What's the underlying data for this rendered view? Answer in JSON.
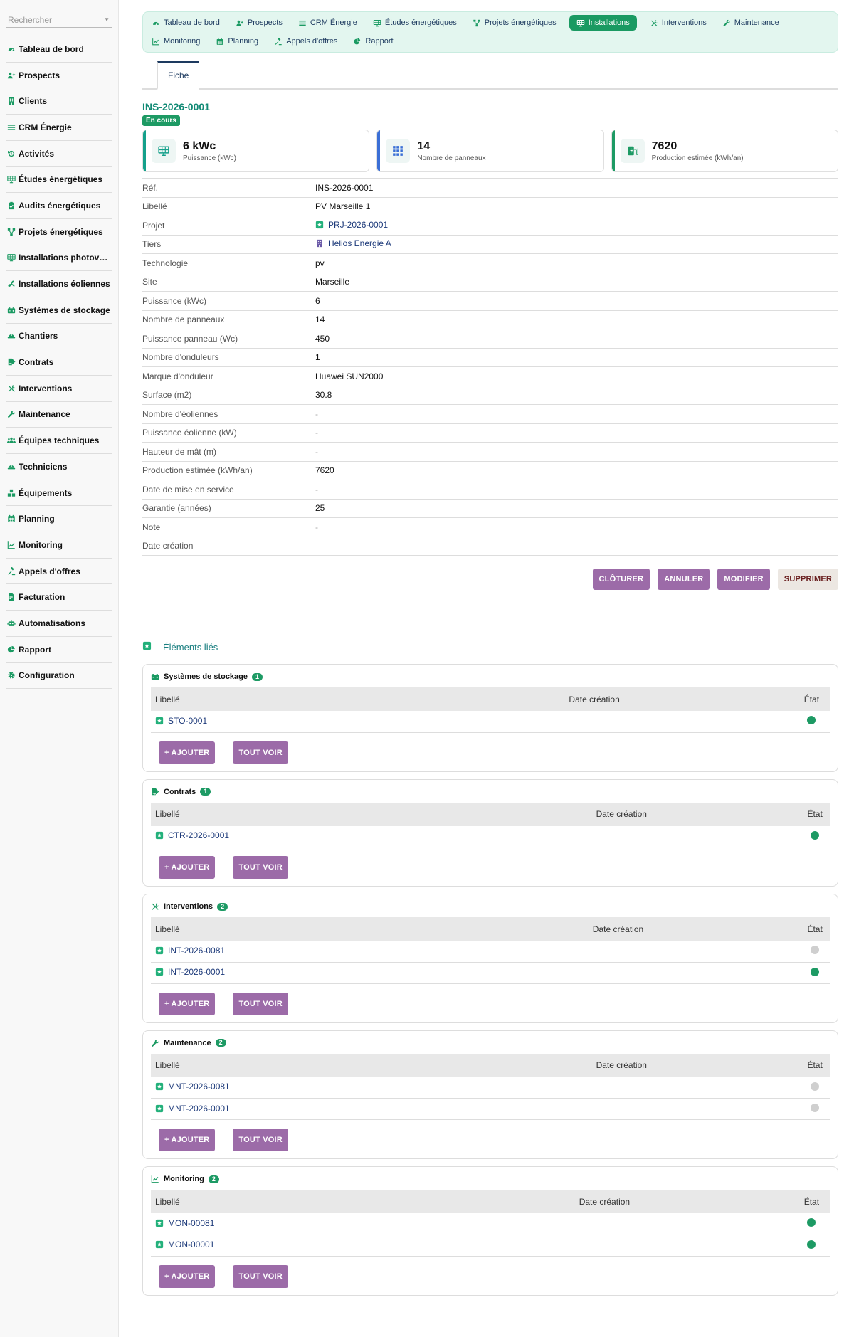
{
  "colors": {
    "accent": "#1a9a62",
    "brand_text": "#1d3a5f",
    "title": "#128a75",
    "action_purple": "#9c6ba8",
    "status_green": "#1d9a64",
    "status_grey": "#cfcfcf"
  },
  "sidebar": {
    "search_placeholder": "Rechercher",
    "items": [
      {
        "label": "Tableau de bord",
        "icon": "gauge-icon"
      },
      {
        "label": "Prospects",
        "icon": "user-plus-icon"
      },
      {
        "label": "Clients",
        "icon": "building-icon"
      },
      {
        "label": "CRM Énergie",
        "icon": "bars-icon"
      },
      {
        "label": "Activités",
        "icon": "history-icon"
      },
      {
        "label": "Études énergétiques",
        "icon": "solar-panel-icon"
      },
      {
        "label": "Audits énergétiques",
        "icon": "clipboard-check-icon"
      },
      {
        "label": "Projets énergétiques",
        "icon": "network-icon"
      },
      {
        "label": "Installations photovoltaïques",
        "icon": "solar-panel-icon"
      },
      {
        "label": "Installations éoliennes",
        "icon": "fan-icon"
      },
      {
        "label": "Systèmes de stockage",
        "icon": "car-battery-icon"
      },
      {
        "label": "Chantiers",
        "icon": "hard-hat-icon"
      },
      {
        "label": "Contrats",
        "icon": "file-signature-icon"
      },
      {
        "label": "Interventions",
        "icon": "tools-icon"
      },
      {
        "label": "Maintenance",
        "icon": "wrench-icon"
      },
      {
        "label": "Équipes techniques",
        "icon": "users-icon"
      },
      {
        "label": "Techniciens",
        "icon": "hard-hat-icon"
      },
      {
        "label": "Équipements",
        "icon": "boxes-icon"
      },
      {
        "label": "Planning",
        "icon": "calendar-icon"
      },
      {
        "label": "Monitoring",
        "icon": "chart-line-icon"
      },
      {
        "label": "Appels d'offres",
        "icon": "gavel-icon"
      },
      {
        "label": "Facturation",
        "icon": "invoice-icon"
      },
      {
        "label": "Automatisations",
        "icon": "robot-icon"
      },
      {
        "label": "Rapport",
        "icon": "chart-pie-icon"
      },
      {
        "label": "Configuration",
        "icon": "gear-icon"
      }
    ]
  },
  "topnav": [
    {
      "label": "Tableau de bord",
      "icon": "gauge-icon",
      "active": false
    },
    {
      "label": "Prospects",
      "icon": "user-plus-icon",
      "active": false
    },
    {
      "label": "CRM Énergie",
      "icon": "bars-icon",
      "active": false
    },
    {
      "label": "Études énergétiques",
      "icon": "solar-panel-icon",
      "active": false
    },
    {
      "label": "Projets énergétiques",
      "icon": "network-icon",
      "active": false
    },
    {
      "label": "Installations",
      "icon": "solar-panel-icon",
      "active": true
    },
    {
      "label": "Interventions",
      "icon": "tools-icon",
      "active": false
    },
    {
      "label": "Maintenance",
      "icon": "wrench-icon",
      "active": false
    },
    {
      "label": "Monitoring",
      "icon": "chart-line-icon",
      "active": false
    },
    {
      "label": "Planning",
      "icon": "calendar-icon",
      "active": false
    },
    {
      "label": "Appels d'offres",
      "icon": "gavel-icon",
      "active": false
    },
    {
      "label": "Rapport",
      "icon": "chart-pie-icon",
      "active": false
    }
  ],
  "tab": {
    "label": "Fiche"
  },
  "record": {
    "ref": "INS-2026-0001",
    "status": "En cours"
  },
  "kpis": [
    {
      "value": "6 kWc",
      "label": "Puissance (kWc)",
      "color": "#14a08a",
      "icon": "solar-panel-icon"
    },
    {
      "value": "14",
      "label": "Nombre de panneaux",
      "color": "#3b6fd6",
      "icon": "grid-icon"
    },
    {
      "value": "7620",
      "label": "Production estimée (kWh/an)",
      "color": "#1d9a64",
      "icon": "charging-station-icon"
    }
  ],
  "fields": [
    {
      "key": "Réf.",
      "value": "INS-2026-0001"
    },
    {
      "key": "Libellé",
      "value": "PV Marseille 1"
    },
    {
      "key": "Projet",
      "value": "PRJ-2026-0001",
      "link": true,
      "icon": "project-icon"
    },
    {
      "key": "Tiers",
      "value": "Helios Energie A",
      "link": true,
      "icon": "building-icon"
    },
    {
      "key": "Technologie",
      "value": "pv"
    },
    {
      "key": "Site",
      "value": "Marseille"
    },
    {
      "key": "Puissance (kWc)",
      "value": "6"
    },
    {
      "key": "Nombre de panneaux",
      "value": "14"
    },
    {
      "key": "Puissance panneau (Wc)",
      "value": "450"
    },
    {
      "key": "Nombre d'onduleurs",
      "value": "1"
    },
    {
      "key": "Marque d'onduleur",
      "value": "Huawei SUN2000"
    },
    {
      "key": "Surface (m2)",
      "value": "30.8"
    },
    {
      "key": "Nombre d'éoliennes",
      "value": "-",
      "empty": true
    },
    {
      "key": "Puissance éolienne (kW)",
      "value": "-",
      "empty": true
    },
    {
      "key": "Hauteur de mât (m)",
      "value": "-",
      "empty": true
    },
    {
      "key": "Production estimée (kWh/an)",
      "value": "7620"
    },
    {
      "key": "Date de mise en service",
      "value": "-",
      "empty": true
    },
    {
      "key": "Garantie (années)",
      "value": "25"
    },
    {
      "key": "Note",
      "value": "-",
      "empty": true
    },
    {
      "key": "Date création",
      "value": ""
    }
  ],
  "actions": {
    "close": "CLÔTURER",
    "cancel": "ANNULER",
    "edit": "MODIFIER",
    "delete": "SUPPRIMER"
  },
  "linked": {
    "title": "Éléments liés",
    "add_label": "+ AJOUTER",
    "see_all_label": "TOUT VOIR",
    "col_label": "Libellé",
    "col_date": "Date création",
    "col_state": "État",
    "panels": [
      {
        "title": "Systèmes de stockage",
        "count": "1",
        "icon": "car-battery-icon",
        "date_pct": 44,
        "state_pct": 94,
        "rows": [
          {
            "ref": "STO-0001",
            "state": "green"
          }
        ]
      },
      {
        "title": "Contrats",
        "count": "1",
        "icon": "file-signature-icon",
        "date_pct": 51,
        "state_pct": 95,
        "rows": [
          {
            "ref": "CTR-2026-0001",
            "state": "green"
          }
        ]
      },
      {
        "title": "Interventions",
        "count": "2",
        "icon": "tools-icon",
        "date_pct": 50,
        "state_pct": 95,
        "rows": [
          {
            "ref": "INT-2026-0081",
            "state": "grey"
          },
          {
            "ref": "INT-2026-0001",
            "state": "green"
          }
        ]
      },
      {
        "title": "Maintenance",
        "count": "2",
        "icon": "wrench-icon",
        "date_pct": 51,
        "state_pct": 95,
        "rows": [
          {
            "ref": "MNT-2026-0081",
            "state": "grey"
          },
          {
            "ref": "MNT-2026-0001",
            "state": "grey"
          }
        ]
      },
      {
        "title": "Monitoring",
        "count": "2",
        "icon": "chart-line-icon",
        "date_pct": 47,
        "state_pct": 94,
        "rows": [
          {
            "ref": "MON-00081",
            "state": "green"
          },
          {
            "ref": "MON-00001",
            "state": "green"
          }
        ]
      }
    ]
  }
}
